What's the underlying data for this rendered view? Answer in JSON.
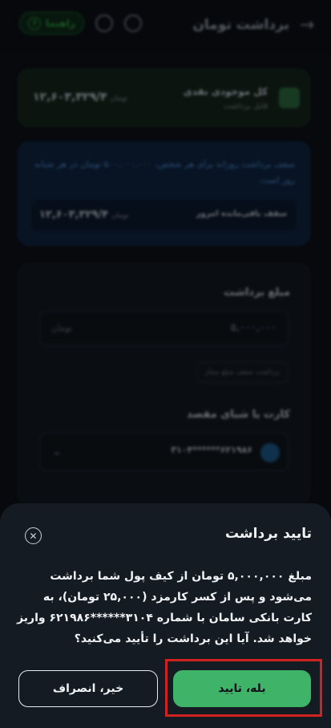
{
  "header": {
    "title": "برداشت تومان",
    "help_label": "راهنما",
    "help_icon": "?"
  },
  "balance": {
    "label": "کل موجودی نقدی",
    "sub_label": "قابل برداشت",
    "amount": "۱۲,۶۰۳,۳۲۹/۴",
    "unit": "تومان"
  },
  "info": {
    "text": "سقف برداشت روزانه برای هر شخص، ۵۰۰,۰۰۰,۰۰۰ تومان در هر شبانه روز است.",
    "remaining_label": "سقف باقی‌مانده امروز",
    "remaining_amount": "۱۲,۶۰۳,۳۲۹/۴",
    "remaining_unit": "تومان"
  },
  "form": {
    "amount_label": "مبلغ برداشت",
    "amount_value": "۵,۰۰۰,۰۰۰",
    "amount_unit": "تومان",
    "limit_chip": "برداشت سقف مبلغ مجاز",
    "card_label": "کارت یا شبای مقصد",
    "card_number": "۳۱۰۴******۶۲۱۹۸۶"
  },
  "dialog": {
    "title": "تایید برداشت",
    "message": "مبلغ ۵,۰۰۰,۰۰۰ تومان از کیف پول شما برداشت می‌شود و پس از کسر کارمزد (۲۵,۰۰۰ تومان)، به کارت بانکی سامان با شماره ۳۱۰۴******۶۲۱۹۸۶ واریز خواهد شد. آیا این برداشت را تأیید می‌کنید؟",
    "confirm_label": "بله، تایید",
    "cancel_label": "خیر، انصراف",
    "close_icon": "✕"
  },
  "colors": {
    "confirm": "#3fb368",
    "highlight": "#d0231f",
    "sheet_bg": "#151b23"
  }
}
